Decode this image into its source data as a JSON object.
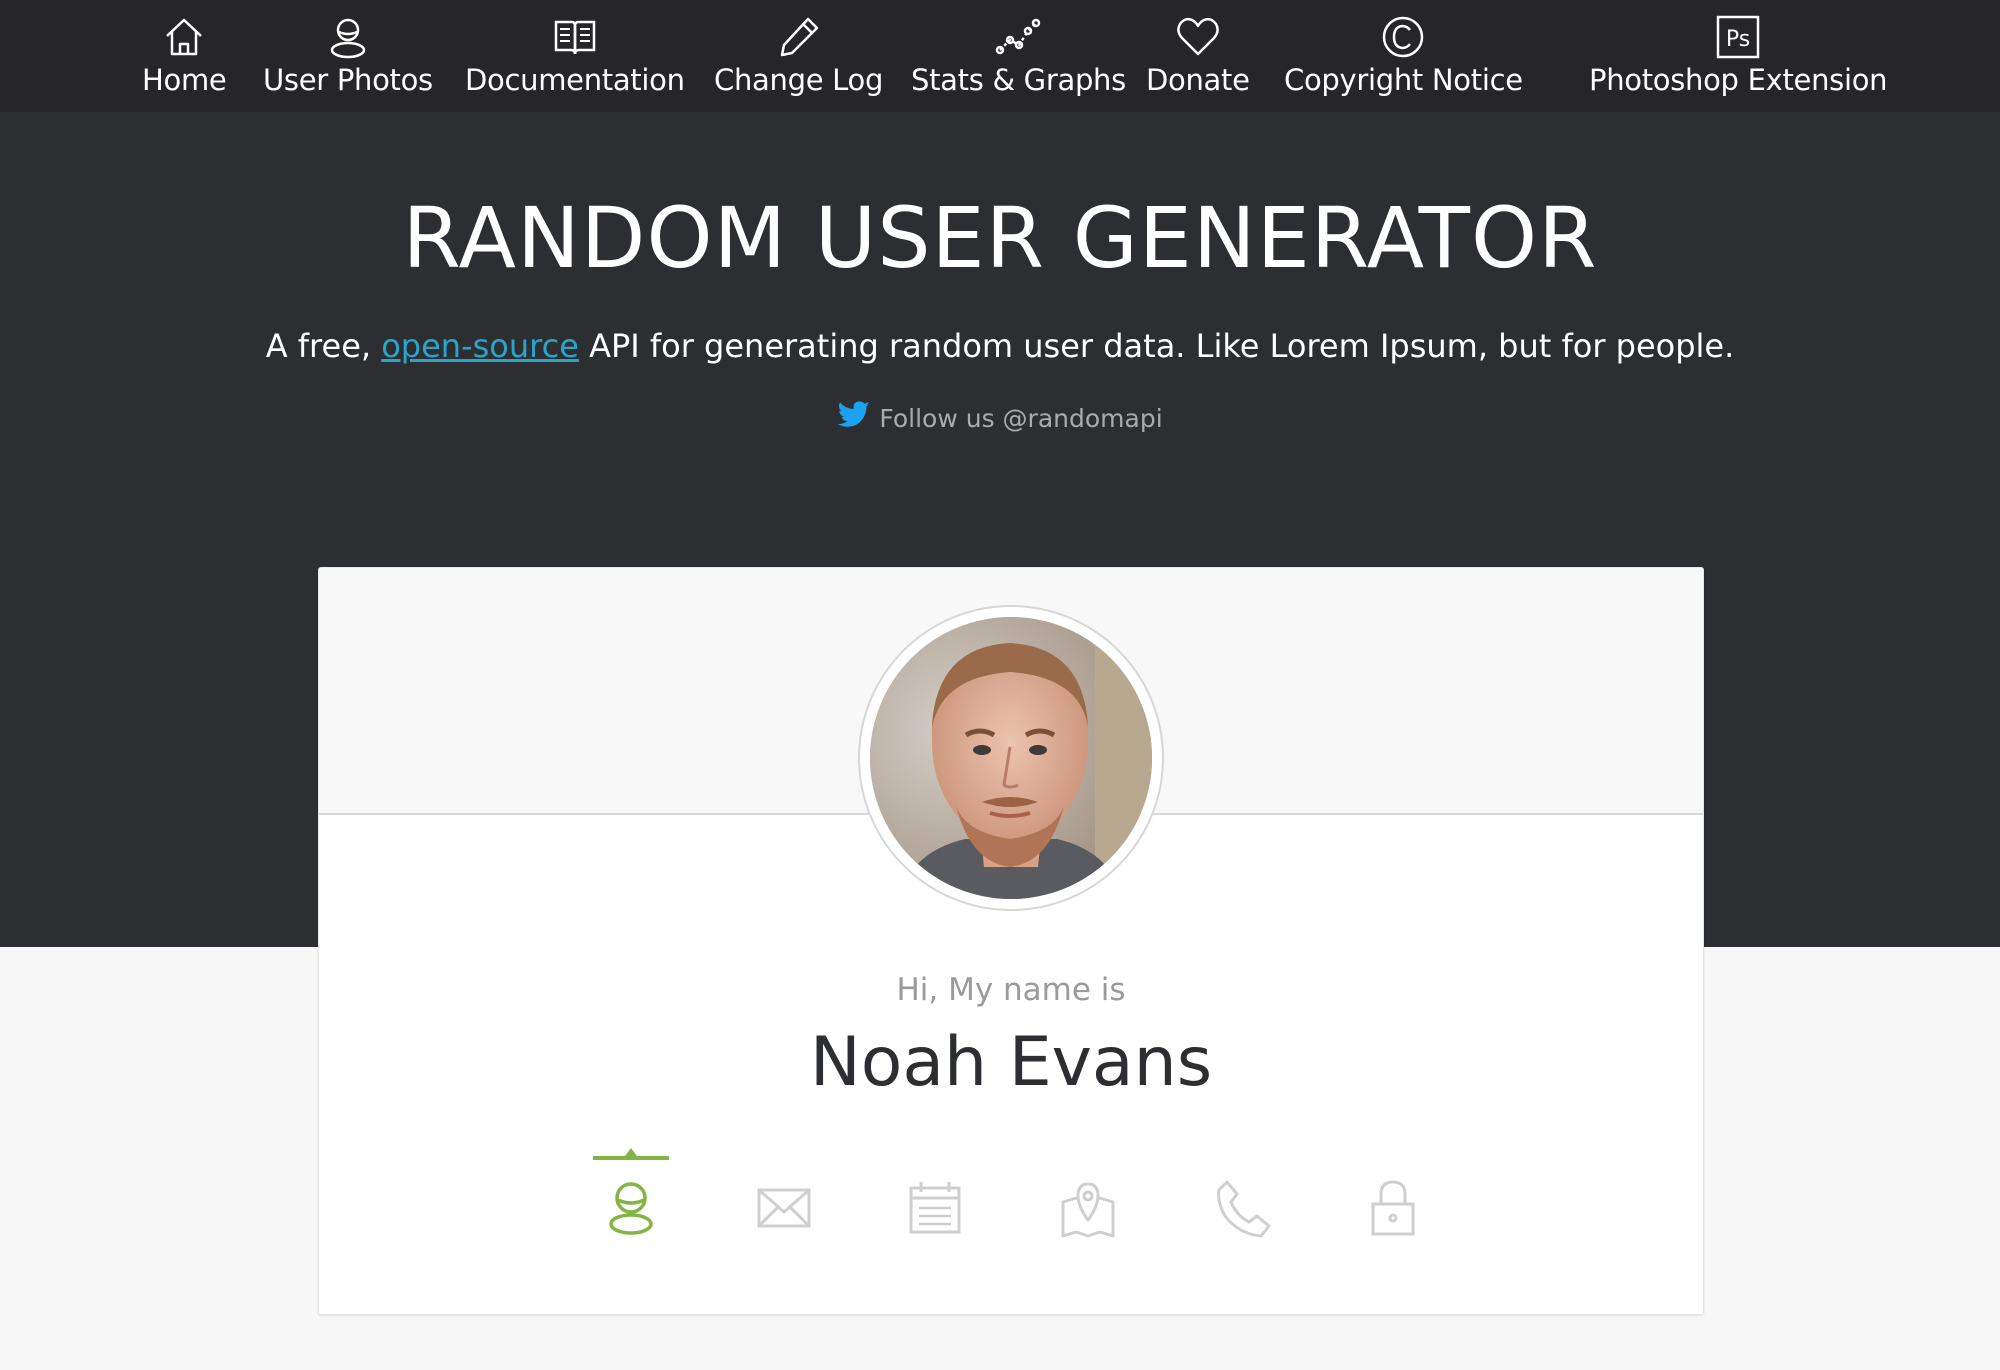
{
  "nav": {
    "items": [
      {
        "label": "Home",
        "icon": "home-icon"
      },
      {
        "label": "User Photos",
        "icon": "user-photos-icon"
      },
      {
        "label": "Documentation",
        "icon": "book-icon"
      },
      {
        "label": "Change Log",
        "icon": "pencil-icon"
      },
      {
        "label": "Stats & Graphs",
        "icon": "graph-icon"
      },
      {
        "label": "Donate",
        "icon": "heart-icon"
      },
      {
        "label": "Copyright Notice",
        "icon": "copyright-icon"
      },
      {
        "label": "Photoshop Extension",
        "icon": "photoshop-icon"
      }
    ],
    "ps_glyph": "Ps"
  },
  "hero": {
    "title": "RANDOM USER GENERATOR",
    "subtitle_before": "A free, ",
    "subtitle_link": "open-source",
    "subtitle_after": " API for generating random user data. Like Lorem Ipsum, but for people.",
    "follow": "Follow us @randomapi"
  },
  "card": {
    "greeting": "Hi, My name is",
    "name": "Noah Evans",
    "tabs": [
      {
        "icon": "user-icon",
        "active": true
      },
      {
        "icon": "envelope-icon",
        "active": false
      },
      {
        "icon": "calendar-icon",
        "active": false
      },
      {
        "icon": "map-icon",
        "active": false
      },
      {
        "icon": "phone-icon",
        "active": false
      },
      {
        "icon": "lock-icon",
        "active": false
      }
    ]
  },
  "colors": {
    "nav_bg": "#262628",
    "hero_bg": "#2c2e31",
    "link": "#2aa5c9",
    "accent_green": "#84b544",
    "icon_inactive": "#cfcfcf",
    "twitter": "#1da1f2"
  }
}
